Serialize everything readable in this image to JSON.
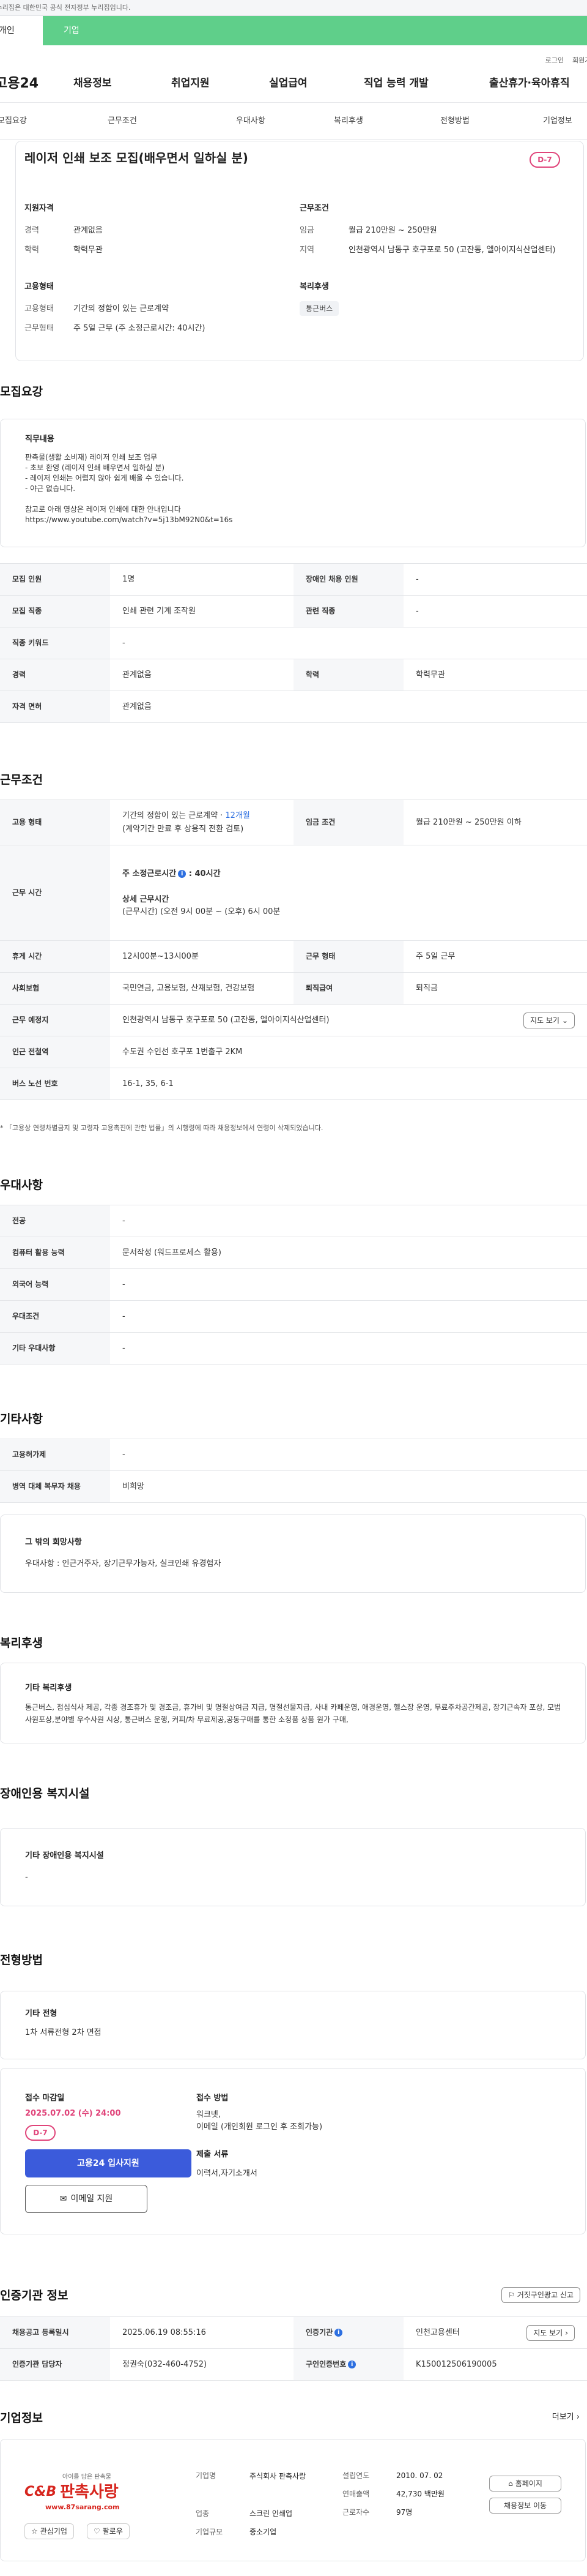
{
  "gov_banner": "이 누리집은 대한민국 공식 전자정부 누리집입니다.",
  "user_tabs": [
    "개인",
    "기업"
  ],
  "util_links": [
    "로그인",
    "회원가입"
  ],
  "gnb": {
    "logo": "고용24",
    "menus": [
      "채용정보",
      "취업지원",
      "실업급여",
      "직업 능력 개발",
      "출산휴가·육아휴직"
    ]
  },
  "subnav": [
    "모집요강",
    "근무조건",
    "우대사항",
    "복리후생",
    "전형방법",
    "기업정보"
  ],
  "job": {
    "title": "레이저 인쇄 보조 모집(배우면서 일하실 분)",
    "dday": "D-7",
    "qualification": {
      "heading": "지원자격",
      "rows": [
        {
          "k": "경력",
          "v": "관계없음"
        },
        {
          "k": "학력",
          "v": "학력무관"
        }
      ]
    },
    "conditions": {
      "heading": "근무조건",
      "rows": [
        {
          "k": "임금",
          "v": "월급 210만원 ~ 250만원"
        },
        {
          "k": "지역",
          "v": "인천광역시 남동구 호구포로 50 (고잔동, 엘아이지식산업센터)"
        }
      ]
    },
    "employment": {
      "heading": "고용형태",
      "rows": [
        {
          "k": "고용형태",
          "v": "기간의 정함이 있는 근로계약"
        },
        {
          "k": "근무형태",
          "v": "주 5일 근무 (주 소정근로시간: 40시간)"
        }
      ]
    },
    "welfare": {
      "heading": "복리후생",
      "chip": "통근버스"
    }
  },
  "recruit": {
    "heading": "모집요강",
    "duty_label": "직무내용",
    "duty_text": "판촉물(생활 소비재) 레이저 인쇄 보조 업무\n - 초보 환영 (레이저 인쇄 배우면서 일하실 분)\n - 레이저 인쇄는 어렵지 않아 쉽게 배울 수 있습니다.\n - 야근 없습니다.\n\n참고로 아래 영상은 레이저 인쇄에 대한 안내입니다\nhttps://www.youtube.com/watch?v=5j13bM92N0&t=16s",
    "table": [
      {
        "k": "모집 인원",
        "v": "1명",
        "k2": "장애인 채용 인원",
        "v2": "-"
      },
      {
        "k": "모집 직종",
        "v": "인쇄 관련 기계 조작원",
        "k2": "관련 직종",
        "v2": "-"
      },
      {
        "k": "직종 키워드",
        "v": "-"
      },
      {
        "k": "경력",
        "v": "관계없음",
        "k2": "학력",
        "v2": "학력무관"
      },
      {
        "k": "자격 면허",
        "v": "관계없음"
      }
    ]
  },
  "work": {
    "heading": "근무조건",
    "emp_type_label": "고용 형태",
    "emp_type_value": "기간의 정함이 있는 근로계약 · ",
    "emp_type_months": "12개월",
    "emp_type_sub": "(계약기간 만료 후 상용직 전환 검토)",
    "wage_label": "임금 조건",
    "wage_value": "월급 210만원 ~ 250만원 이하",
    "hours_label": "근무 시간",
    "hours_weekly": "주 소정근로시간",
    "hours_weekly_val": "40시간",
    "hours_detail_label": "상세 근무시간",
    "hours_detail": "(근무시간) (오전 9시 00분 ~ (오후) 6시 00분",
    "break_label": "휴게 시간",
    "break_value": "12시00분~13시00분",
    "shift_label": "근무 형태",
    "shift_value": "주 5일 근무",
    "insurance_label": "사회보험",
    "insurance_value": "국민연금, 고용보험, 산재보험, 건강보험",
    "severance_label": "퇴직급여",
    "severance_value": "퇴직금",
    "place_label": "근무 예정지",
    "place_value": "인천광역시 남동구 호구포로 50 (고잔동, 엘아이지식산업센터)",
    "map_btn": "지도 보기",
    "station_label": "인근 전철역",
    "station_value": "수도권 수인선 호구포 1번출구 2KM",
    "bus_label": "버스 노선 번호",
    "bus_value": "16-1, 35, 6-1",
    "note": "* 「고용상 연령차별금지 및 고령자 고용촉진에 관한 법률」의 시행령에 따라 채용정보에서 연령이 삭제되었습니다."
  },
  "prefer": {
    "heading": "우대사항",
    "rows": [
      {
        "k": "전공",
        "v": "-"
      },
      {
        "k": "컴퓨터 활용 능력",
        "v": "문서작성 (워드프로세스 활용)"
      },
      {
        "k": "외국어 능력",
        "v": "-"
      },
      {
        "k": "우대조건",
        "v": "-"
      },
      {
        "k": "기타 우대사항",
        "v": "-"
      }
    ]
  },
  "other": {
    "heading": "기타사항",
    "rows": [
      {
        "k": "고용허가제",
        "v": "-"
      },
      {
        "k": "병역 대체 복무자 채용",
        "v": "비희망"
      }
    ],
    "extra_label": "그 밖의 희망사항",
    "extra_text": "우대사항 : 인근거주자, 장기근무가능자, 실크인쇄 유경험자"
  },
  "benefits": {
    "heading": "복리후생",
    "label": "기타 복리후생",
    "text": "통근버스, 점심식사 제공, 각종 경조휴가 및 경조금, 휴가비 및 명절상여금 지급, 명절선물지급, 사내 카페운영, 애경운영, 헬스장 운영, 무료주차공간제공, 장기근속자 포상, 모범사원포상,분야별 우수사원 시상, 통근버스 운행, 커피/차 무료제공,공동구매를 통한 소정품 상품 원가 구매,"
  },
  "disability": {
    "heading": "장애인용 복지시설",
    "label": "기타 장애인용 복지시설",
    "text": "-"
  },
  "selection": {
    "heading": "전형방법",
    "label": "기타 전형",
    "text": "1차 서류전형 2차 면접"
  },
  "apply": {
    "deadline_label": "접수 마감일",
    "deadline_value": "2025.07.02 (수) 24:00",
    "dday": "D-7",
    "apply_btn": "고용24 입사지원",
    "email_btn": "이메일 지원",
    "method_label": "접수 방법",
    "method_value": "워크넷,\n이메일 (개인회원 로그인 후 조회가능)",
    "docs_label": "제출 서류",
    "docs_value": "이력서,자기소개서"
  },
  "agency": {
    "heading": "인증기관 정보",
    "report_btn": "거짓구인광고 신고",
    "reg_date_label": "채용공고 등록일시",
    "reg_date_value": "2025.06.19 08:55:16",
    "agency_label": "인증기관",
    "agency_value": "인천고용센터",
    "map_btn": "지도 보기",
    "manager_label": "인증기관 담당자",
    "manager_value": "정권숙(032-460-4752)",
    "number_label": "구인인증번호",
    "number_value": "K150012506190005"
  },
  "company": {
    "heading": "기업정보",
    "more": "더보기",
    "logo_tag": "아이를 담은 판촉물",
    "logo_name": "판촉사랑",
    "logo_url": "www.87sarang.com",
    "fav_btn": "관심기업",
    "follow_btn": "팔로우",
    "name_label": "기업명",
    "name_value": "주식회사 판촉사랑",
    "industry_label": "업종",
    "industry_value": "스크린 인쇄업",
    "size_label": "기업규모",
    "size_value": "중소기업",
    "founded_label": "설립연도",
    "founded_value": "2010. 07. 02",
    "revenue_label": "연매출액",
    "revenue_value": "42,730 백만원",
    "employees_label": "근로자수",
    "employees_value": "97명",
    "home_btn": "홈페이지",
    "jobs_btn": "채용정보 이동"
  }
}
